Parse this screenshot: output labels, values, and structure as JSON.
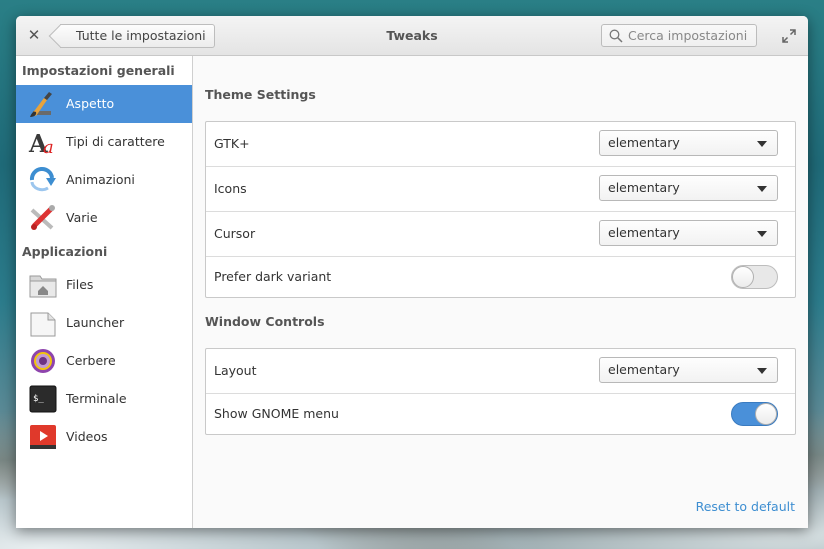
{
  "window": {
    "title": "Tweaks",
    "back_label": "Tutte le impostazioni",
    "search_placeholder": "Cerca impostazioni"
  },
  "sidebar": {
    "general_header": "Impostazioni generali",
    "general_items": [
      {
        "label": "Aspetto",
        "icon": "paintbrush-icon",
        "active": true
      },
      {
        "label": "Tipi di carattere",
        "icon": "font-icon",
        "active": false
      },
      {
        "label": "Animazioni",
        "icon": "animation-arrow-icon",
        "active": false
      },
      {
        "label": "Varie",
        "icon": "tools-icon",
        "active": false
      }
    ],
    "apps_header": "Applicazioni",
    "app_items": [
      {
        "label": "Files",
        "icon": "folder-home-icon"
      },
      {
        "label": "Launcher",
        "icon": "launcher-icon"
      },
      {
        "label": "Cerbere",
        "icon": "cerbere-icon"
      },
      {
        "label": "Terminale",
        "icon": "terminal-icon"
      },
      {
        "label": "Videos",
        "icon": "video-player-icon"
      }
    ]
  },
  "theme": {
    "title": "Theme Settings",
    "gtk_label": "GTK+",
    "gtk_value": "elementary",
    "icons_label": "Icons",
    "icons_value": "elementary",
    "cursor_label": "Cursor",
    "cursor_value": "elementary",
    "dark_label": "Prefer dark variant",
    "dark_enabled": false
  },
  "window_controls": {
    "title": "Window Controls",
    "layout_label": "Layout",
    "layout_value": "elementary",
    "gnome_menu_label": "Show GNOME menu",
    "gnome_menu_enabled": true
  },
  "reset_label": "Reset to default",
  "colors": {
    "accent": "#4a90d9",
    "link": "#3d8ed1"
  }
}
